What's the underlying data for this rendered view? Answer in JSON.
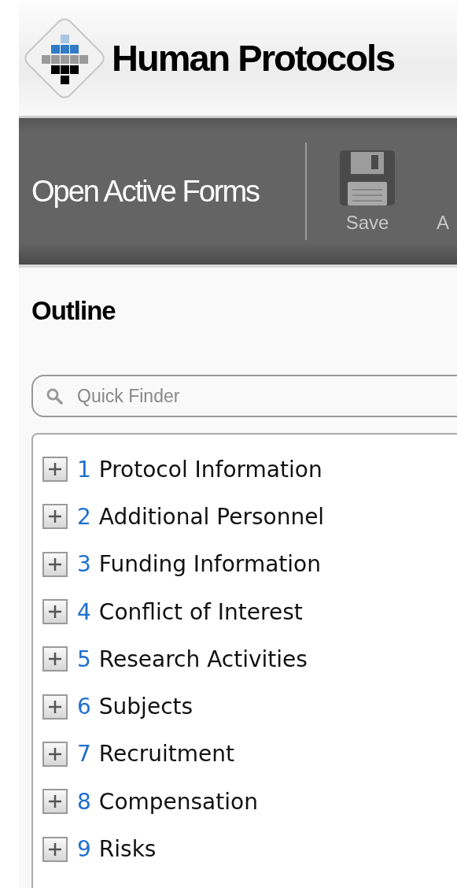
{
  "header": {
    "title": "Human Protocols"
  },
  "toolbar": {
    "title": "Open Active Forms",
    "buttons": [
      {
        "kind": "save",
        "label": "Save"
      },
      {
        "kind": "other",
        "label": "A"
      }
    ]
  },
  "outline": {
    "heading": "Outline",
    "search": {
      "placeholder": "Quick Finder"
    },
    "items": [
      {
        "number": "1",
        "label": "Protocol Information",
        "expanded": false
      },
      {
        "number": "2",
        "label": "Additional Personnel",
        "expanded": false
      },
      {
        "number": "3",
        "label": "Funding Information",
        "expanded": false
      },
      {
        "number": "4",
        "label": "Conflict of Interest",
        "expanded": false
      },
      {
        "number": "5",
        "label": "Research Activities",
        "expanded": false
      },
      {
        "number": "6",
        "label": "Subjects",
        "expanded": false
      },
      {
        "number": "7",
        "label": "Recruitment",
        "expanded": false
      },
      {
        "number": "8",
        "label": "Compensation",
        "expanded": false
      },
      {
        "number": "9",
        "label": "Risks",
        "expanded": false
      }
    ]
  }
}
